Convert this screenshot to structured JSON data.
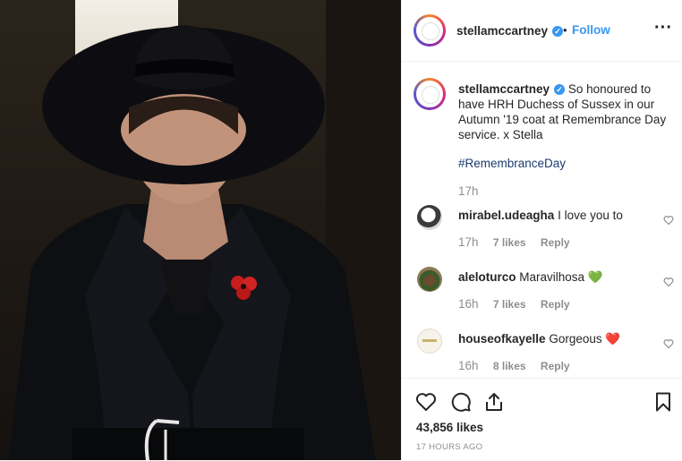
{
  "header": {
    "username": "stellamccartney",
    "separator": "•",
    "follow_label": "Follow",
    "more_icon": "more-horizontal-icon"
  },
  "caption": {
    "username": "stellamccartney",
    "text": "So honoured to have HRH Duchess of Sussex in our Autumn '19 coat at Remembrance Day service. x Stella",
    "hashtag": "#RemembranceDay",
    "time": "17h"
  },
  "comments": [
    {
      "username": "mirabel.udeagha",
      "text": "I love you to",
      "time": "17h",
      "likes": "7 likes",
      "reply": "Reply",
      "emoji": ""
    },
    {
      "username": "aleloturco",
      "text": "Maravilhosa",
      "time": "16h",
      "likes": "7 likes",
      "reply": "Reply",
      "emoji": "💚"
    },
    {
      "username": "houseofkayelle",
      "text": "Gorgeous",
      "time": "16h",
      "likes": "8 likes",
      "reply": "Reply",
      "emoji": "❤️"
    }
  ],
  "post": {
    "likes": "43,856 likes",
    "time_ago": "17 HOURS AGO"
  },
  "colors": {
    "accent": "#3897f0",
    "text": "#262626",
    "muted": "#8e8e8e",
    "hashtag": "#1a3a6e"
  }
}
